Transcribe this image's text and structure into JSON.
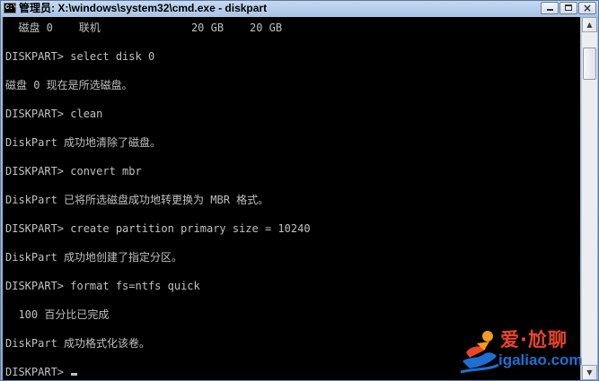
{
  "window": {
    "title": "管理员: X:\\windows\\system32\\cmd.exe - diskpart",
    "icon_label": "C:\\",
    "buttons": [
      "minimize",
      "maximize",
      "close"
    ]
  },
  "console": {
    "lines": [
      "  磁盘 0    联机              20 GB    20 GB",
      "",
      "DISKPART> select disk 0",
      "",
      "磁盘 0 现在是所选磁盘。",
      "",
      "DISKPART> clean",
      "",
      "DiskPart 成功地清除了磁盘。",
      "",
      "DISKPART> convert mbr",
      "",
      "DiskPart 已将所选磁盘成功地转更换为 MBR 格式。",
      "",
      "DISKPART> create partition primary size = 10240",
      "",
      "DiskPart 成功地创建了指定分区。",
      "",
      "DISKPART> format fs=ntfs quick",
      "",
      "  100 百分比已完成",
      "",
      "DiskPart 成功格式化该卷。",
      "",
      "DISKPART> "
    ]
  },
  "watermark": {
    "brand": "爱·尬聊",
    "url": "igaliao.com"
  },
  "colors": {
    "console_bg": "#000000",
    "console_fg": "#c0c0c0",
    "brand_red": "#e8452c",
    "brand_blue": "#1f6fd0"
  }
}
